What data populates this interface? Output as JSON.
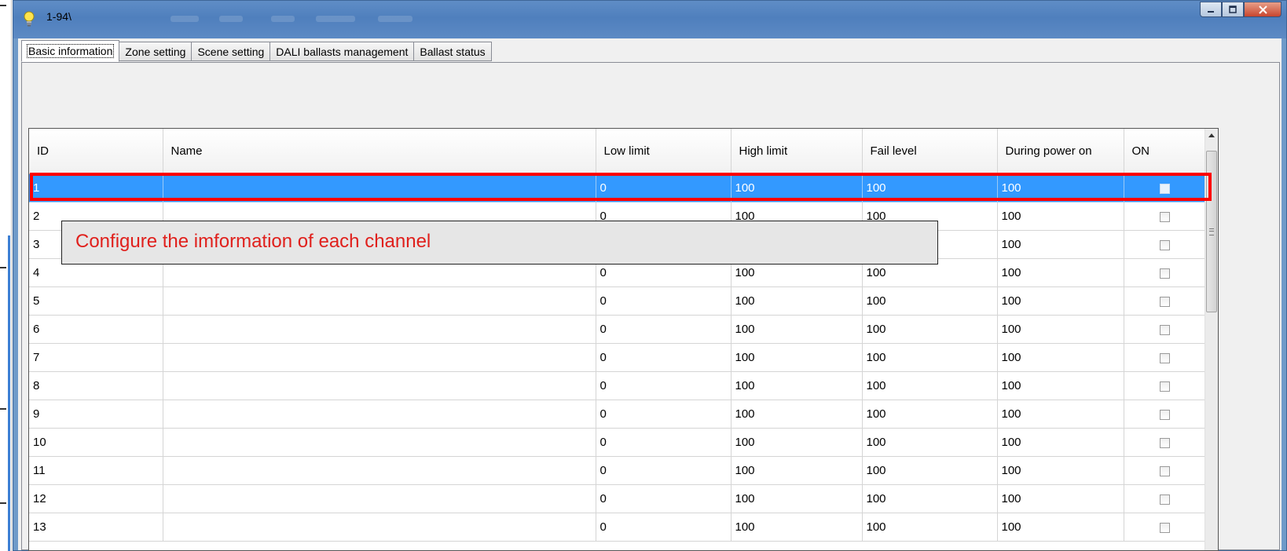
{
  "window": {
    "title": "1-94\\",
    "app_icon": "lightbulb-icon",
    "caption_buttons": [
      "minimize-icon",
      "maximize-icon",
      "close-icon"
    ]
  },
  "tabs": [
    {
      "label": "Basic information",
      "active": true
    },
    {
      "label": "Zone setting"
    },
    {
      "label": "Scene setting"
    },
    {
      "label": "DALI ballasts management"
    },
    {
      "label": "Ballast status"
    }
  ],
  "table": {
    "columns": [
      "ID",
      "Name",
      "Low limit",
      "High limit",
      "Fail level",
      "During power on",
      "ON"
    ],
    "selected_row_id": "1",
    "rows": [
      {
        "id": "1",
        "name": "",
        "low": "0",
        "high": "100",
        "fail": "100",
        "power_on": "100",
        "on": false
      },
      {
        "id": "2",
        "name": "",
        "low": "0",
        "high": "100",
        "fail": "100",
        "power_on": "100",
        "on": false
      },
      {
        "id": "3",
        "name": "",
        "low": "",
        "high": "",
        "fail": "",
        "power_on": "100",
        "on": false
      },
      {
        "id": "4",
        "name": "",
        "low": "0",
        "high": "100",
        "fail": "100",
        "power_on": "100",
        "on": false
      },
      {
        "id": "5",
        "name": "",
        "low": "0",
        "high": "100",
        "fail": "100",
        "power_on": "100",
        "on": false
      },
      {
        "id": "6",
        "name": "",
        "low": "0",
        "high": "100",
        "fail": "100",
        "power_on": "100",
        "on": false
      },
      {
        "id": "7",
        "name": "",
        "low": "0",
        "high": "100",
        "fail": "100",
        "power_on": "100",
        "on": false
      },
      {
        "id": "8",
        "name": "",
        "low": "0",
        "high": "100",
        "fail": "100",
        "power_on": "100",
        "on": false
      },
      {
        "id": "9",
        "name": "",
        "low": "0",
        "high": "100",
        "fail": "100",
        "power_on": "100",
        "on": false
      },
      {
        "id": "10",
        "name": "",
        "low": "0",
        "high": "100",
        "fail": "100",
        "power_on": "100",
        "on": false
      },
      {
        "id": "11",
        "name": "",
        "low": "0",
        "high": "100",
        "fail": "100",
        "power_on": "100",
        "on": false
      },
      {
        "id": "12",
        "name": "",
        "low": "0",
        "high": "100",
        "fail": "100",
        "power_on": "100",
        "on": false
      },
      {
        "id": "13",
        "name": "",
        "low": "0",
        "high": "100",
        "fail": "100",
        "power_on": "100",
        "on": false
      }
    ]
  },
  "annotation": {
    "callout_text": "Configure the imformation of each channel",
    "highlight_color": "#ff0000",
    "text_color": "#e0201c"
  },
  "colors": {
    "selection": "#3399ff",
    "titlebar": "#5f8dc6"
  }
}
